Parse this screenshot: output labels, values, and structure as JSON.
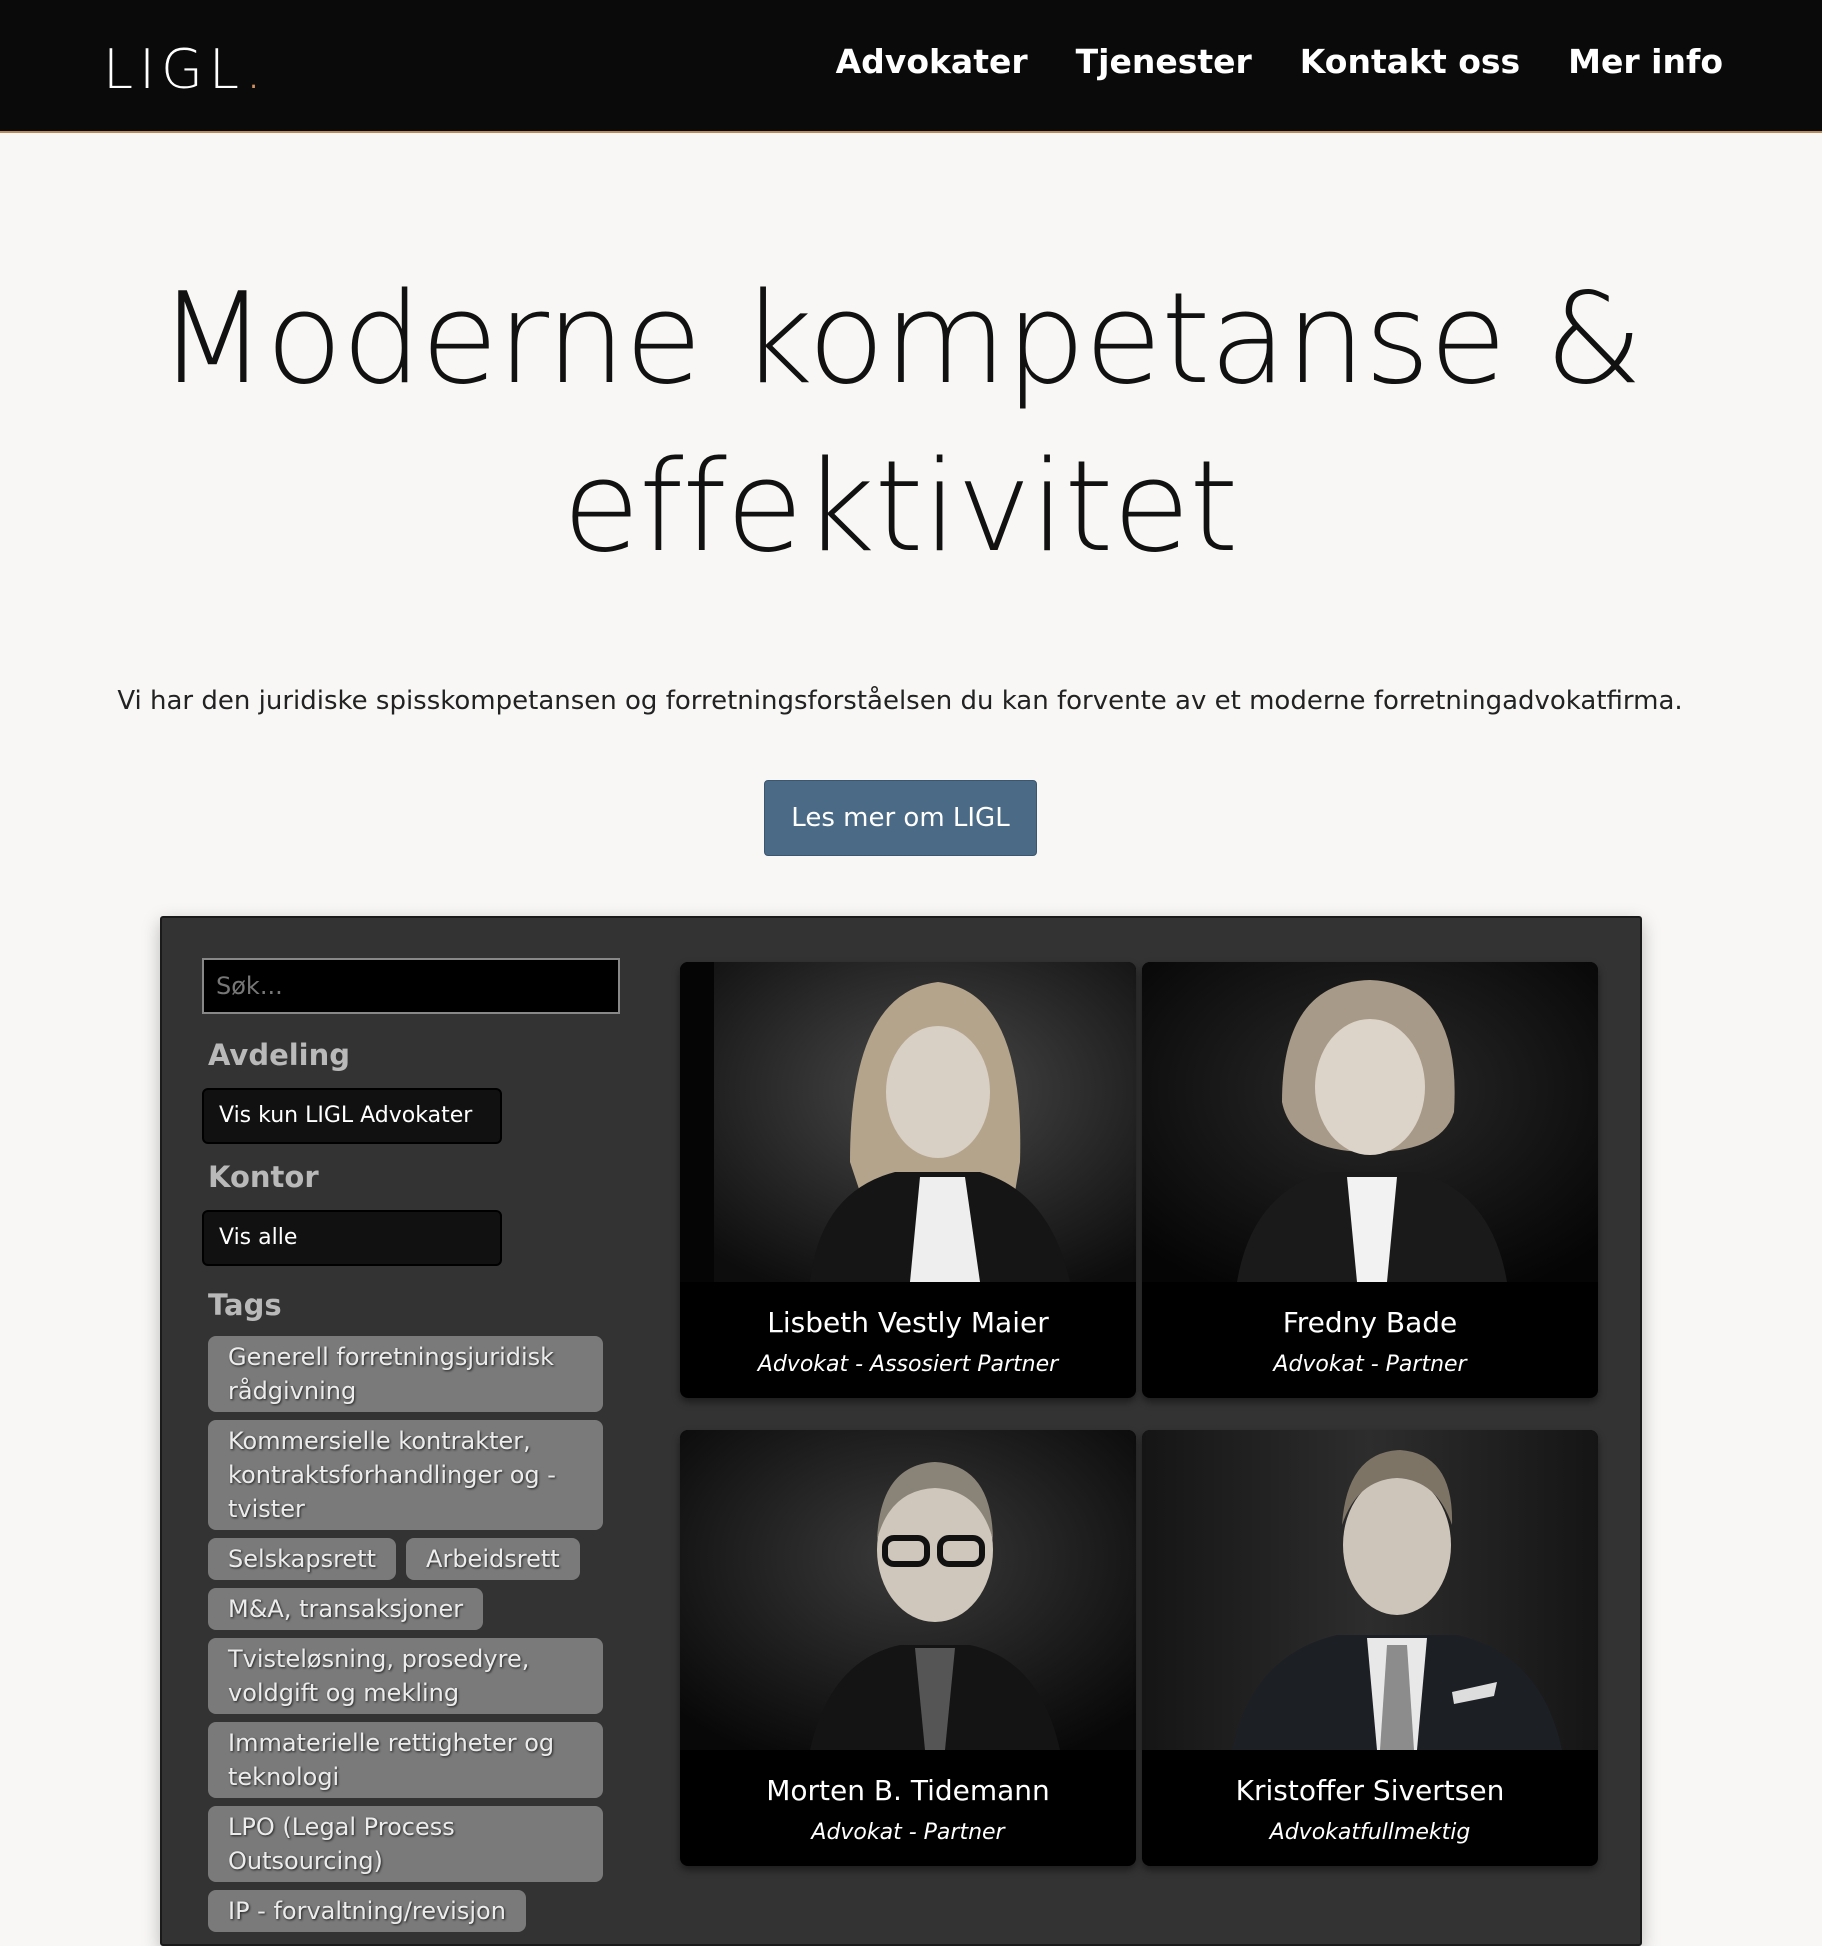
{
  "header": {
    "logo": "LIGL",
    "logo_dot": ".",
    "nav": [
      "Advokater",
      "Tjenester",
      "Kontakt oss",
      "Mer info"
    ]
  },
  "hero": {
    "title_line1": "Moderne kompetanse &",
    "title_line2": "effektivitet",
    "subtitle": "Vi har den juridiske spisskompetansen og forretningsforståelsen du kan forvente av et moderne forretningadvokatfirma.",
    "cta_label": "Les mer om LIGL"
  },
  "filters": {
    "search_placeholder": "Søk...",
    "department_label": "Avdeling",
    "department_value": "Vis kun LIGL Advokater",
    "office_label": "Kontor",
    "office_value": "Vis alle",
    "tags_label": "Tags",
    "tags": [
      "Generell forretningsjuridisk rådgivning",
      "Kommersielle kontrakter, kontraktsforhandlinger og -tvister",
      "Selskapsrett",
      "Arbeidsrett",
      "M&A, transaksjoner",
      "Tvisteløsning, prosedyre, voldgift og mekling",
      "Immaterielle rettigheter og teknologi",
      "LPO (Legal Process Outsourcing)",
      "IP - forvaltning/revisjon"
    ]
  },
  "lawyers": [
    {
      "name": "Lisbeth Vestly Maier",
      "role": "Advokat - Assosiert Partner"
    },
    {
      "name": "Fredny Bade",
      "role": "Advokat - Partner"
    },
    {
      "name": "Morten B. Tidemann",
      "role": "Advokat - Partner"
    },
    {
      "name": "Kristoffer Sivertsen",
      "role": "Advokatfullmektig"
    }
  ],
  "colors": {
    "header_bg": "#0a0a0a",
    "accent": "#d09060",
    "cta_bg": "#4a6a86",
    "panel_bg": "#333333",
    "tag_bg": "#7a7a7a"
  }
}
